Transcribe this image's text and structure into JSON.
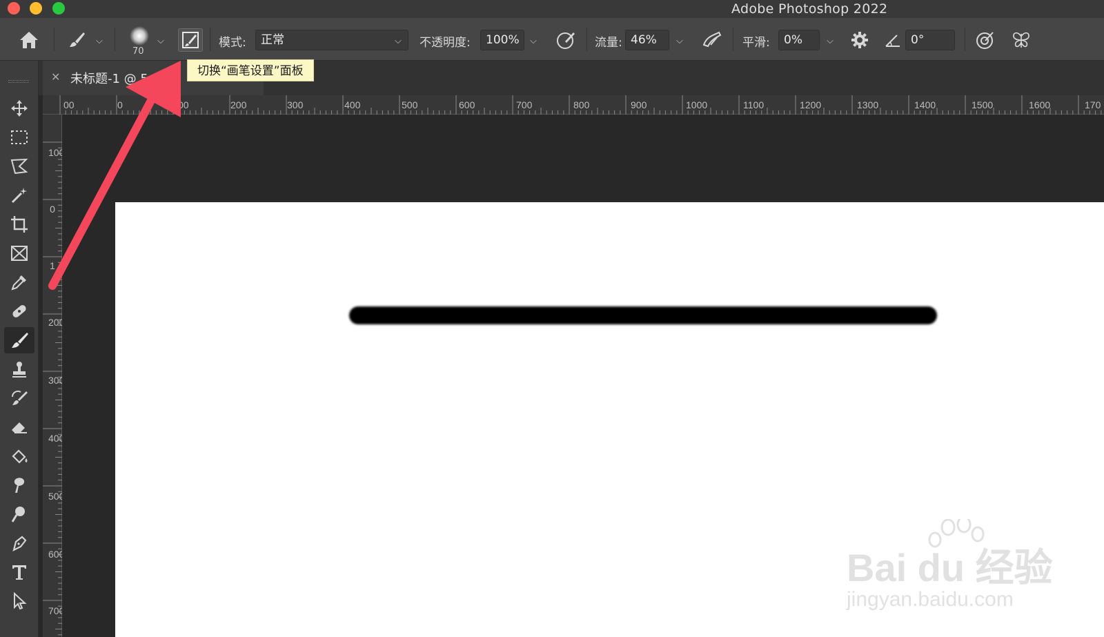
{
  "window": {
    "title": "Adobe Photoshop 2022",
    "colors": {
      "close": "#fe5f57",
      "minimize": "#febc2e",
      "maximize": "#28c840"
    }
  },
  "options_bar": {
    "brush_size": "70",
    "mode_label": "模式:",
    "mode_value": "正常",
    "opacity_label": "不透明度:",
    "opacity_value": "100%",
    "flow_label": "流量:",
    "flow_value": "46%",
    "smoothing_label": "平滑:",
    "smoothing_value": "0%",
    "angle_value": "0°"
  },
  "tooltip": "切换“画笔设置”面板",
  "document_tab": {
    "title": "未标题-1 @ 5",
    "title_tail": "%"
  },
  "rulers": {
    "horizontal": [
      "00",
      "0",
      "00",
      "200",
      "300",
      "400",
      "500",
      "600",
      "700",
      "800",
      "900",
      "1000",
      "1100",
      "1200",
      "1300",
      "1400",
      "1500",
      "1600",
      "170"
    ],
    "vertical": [
      "100",
      "0",
      "1",
      "200",
      "300",
      "400",
      "500",
      "600",
      "700"
    ]
  },
  "toolbar": {
    "tools": [
      "move-tool",
      "marquee-tool",
      "lasso-tool",
      "magic-wand-tool",
      "crop-tool",
      "frame-tool",
      "eyedropper-tool",
      "healing-brush-tool",
      "brush-tool",
      "clone-stamp-tool",
      "history-brush-tool",
      "eraser-tool",
      "paint-bucket-tool",
      "smudge-tool",
      "dodge-tool",
      "pen-tool",
      "type-tool",
      "path-selection-tool"
    ],
    "active": "brush-tool"
  },
  "annotation": {
    "arrow_color": "#f5475b"
  },
  "watermark": {
    "brand": "Bai du 经验",
    "url": "jingyan.baidu.com"
  }
}
